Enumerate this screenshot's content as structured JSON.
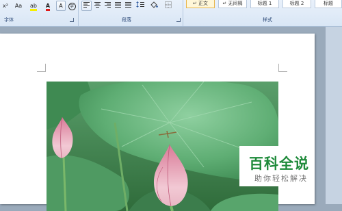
{
  "ribbon": {
    "font_group": {
      "label": "字体",
      "superscript_label": "x²",
      "grow_font_label": "Aa",
      "highlight_label": "ab",
      "font_color_label": "A",
      "clear_format_label": "A",
      "enclose_label": "字"
    },
    "paragraph_group": {
      "label": "段落"
    },
    "styles_group": {
      "label": "样式",
      "styles": [
        "↵ 正文",
        "↵ 无间隔",
        "标题 1",
        "标题 2",
        "标题"
      ]
    }
  },
  "watermark": {
    "title": "百科全说",
    "subtitle": "助你轻松解决"
  },
  "colors": {
    "ribbon_bg": "#dce8f6",
    "workspace": "#9aaabb",
    "watermark_green": "#1e8a3a"
  }
}
